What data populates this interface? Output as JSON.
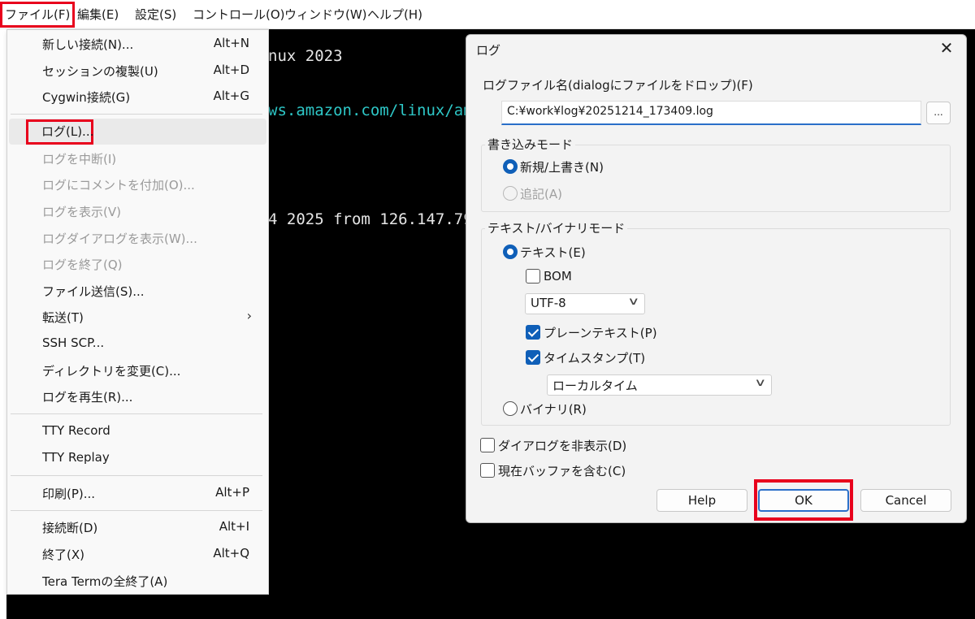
{
  "menubar": {
    "items": [
      "ファイル(F)",
      "編集(E)",
      "設定(S)",
      "コントロール(O)",
      "ウィンドウ(W)",
      "ヘルプ(H)"
    ]
  },
  "terminal": {
    "lines": [
      "nux 2023",
      "ws.amazon.com/linux/am",
      "4 2025 from 126.147.79"
    ]
  },
  "file_menu": {
    "items": [
      {
        "label": "新しい接続(N)...",
        "shortcut": "Alt+N"
      },
      {
        "label": "セッションの複製(U)",
        "shortcut": "Alt+D"
      },
      {
        "label": "Cygwin接続(G)",
        "shortcut": "Alt+G"
      },
      {
        "label": "ログ(L)..."
      },
      {
        "label": "ログを中断(I)"
      },
      {
        "label": "ログにコメントを付加(O)..."
      },
      {
        "label": "ログを表示(V)"
      },
      {
        "label": "ログダイアログを表示(W)..."
      },
      {
        "label": "ログを終了(Q)"
      },
      {
        "label": "ファイル送信(S)..."
      },
      {
        "label": "転送(T)"
      },
      {
        "label": "SSH SCP..."
      },
      {
        "label": "ディレクトリを変更(C)..."
      },
      {
        "label": "ログを再生(R)..."
      },
      {
        "label": "TTY Record"
      },
      {
        "label": "TTY Replay"
      },
      {
        "label": "印刷(P)...",
        "shortcut": "Alt+P"
      },
      {
        "label": "接続断(D)",
        "shortcut": "Alt+I"
      },
      {
        "label": "終了(X)",
        "shortcut": "Alt+Q"
      },
      {
        "label": "Tera Termの全終了(A)"
      }
    ],
    "submenu_arrow": "chevron-right-icon"
  },
  "log_dialog": {
    "title": "ログ",
    "close_icon": "close-icon",
    "filename_label": "ログファイル名(dialogにファイルをドロップ)",
    "filename_key": "(F)",
    "filename_value": "C:¥work¥log¥20251214_173409.log",
    "browse_label": "...",
    "write_mode": {
      "label": "書き込みモード",
      "new_overwrite": "新規/上書き(N)",
      "append": "追記(A)"
    },
    "text_binary_mode": {
      "label": "テキスト/バイナリモード",
      "text": "テキスト(E)",
      "bom": "BOM",
      "encoding": "UTF-8",
      "plain_text": "プレーンテキスト(P)",
      "timestamp": "タイムスタンプ(T)",
      "timestamp_type": "ローカルタイム",
      "binary": "バイナリ(R)"
    },
    "hide_dialog": "ダイアログを非表示(D)",
    "include_buffer": "現在バッファを含む(C)",
    "buttons": {
      "help": "Help",
      "ok": "OK",
      "cancel": "Cancel"
    }
  },
  "colors": {
    "highlight": "#e8001c",
    "accent": "#0f5fb8",
    "terminal_bg": "#000000",
    "terminal_link": "#2ec8c8"
  }
}
